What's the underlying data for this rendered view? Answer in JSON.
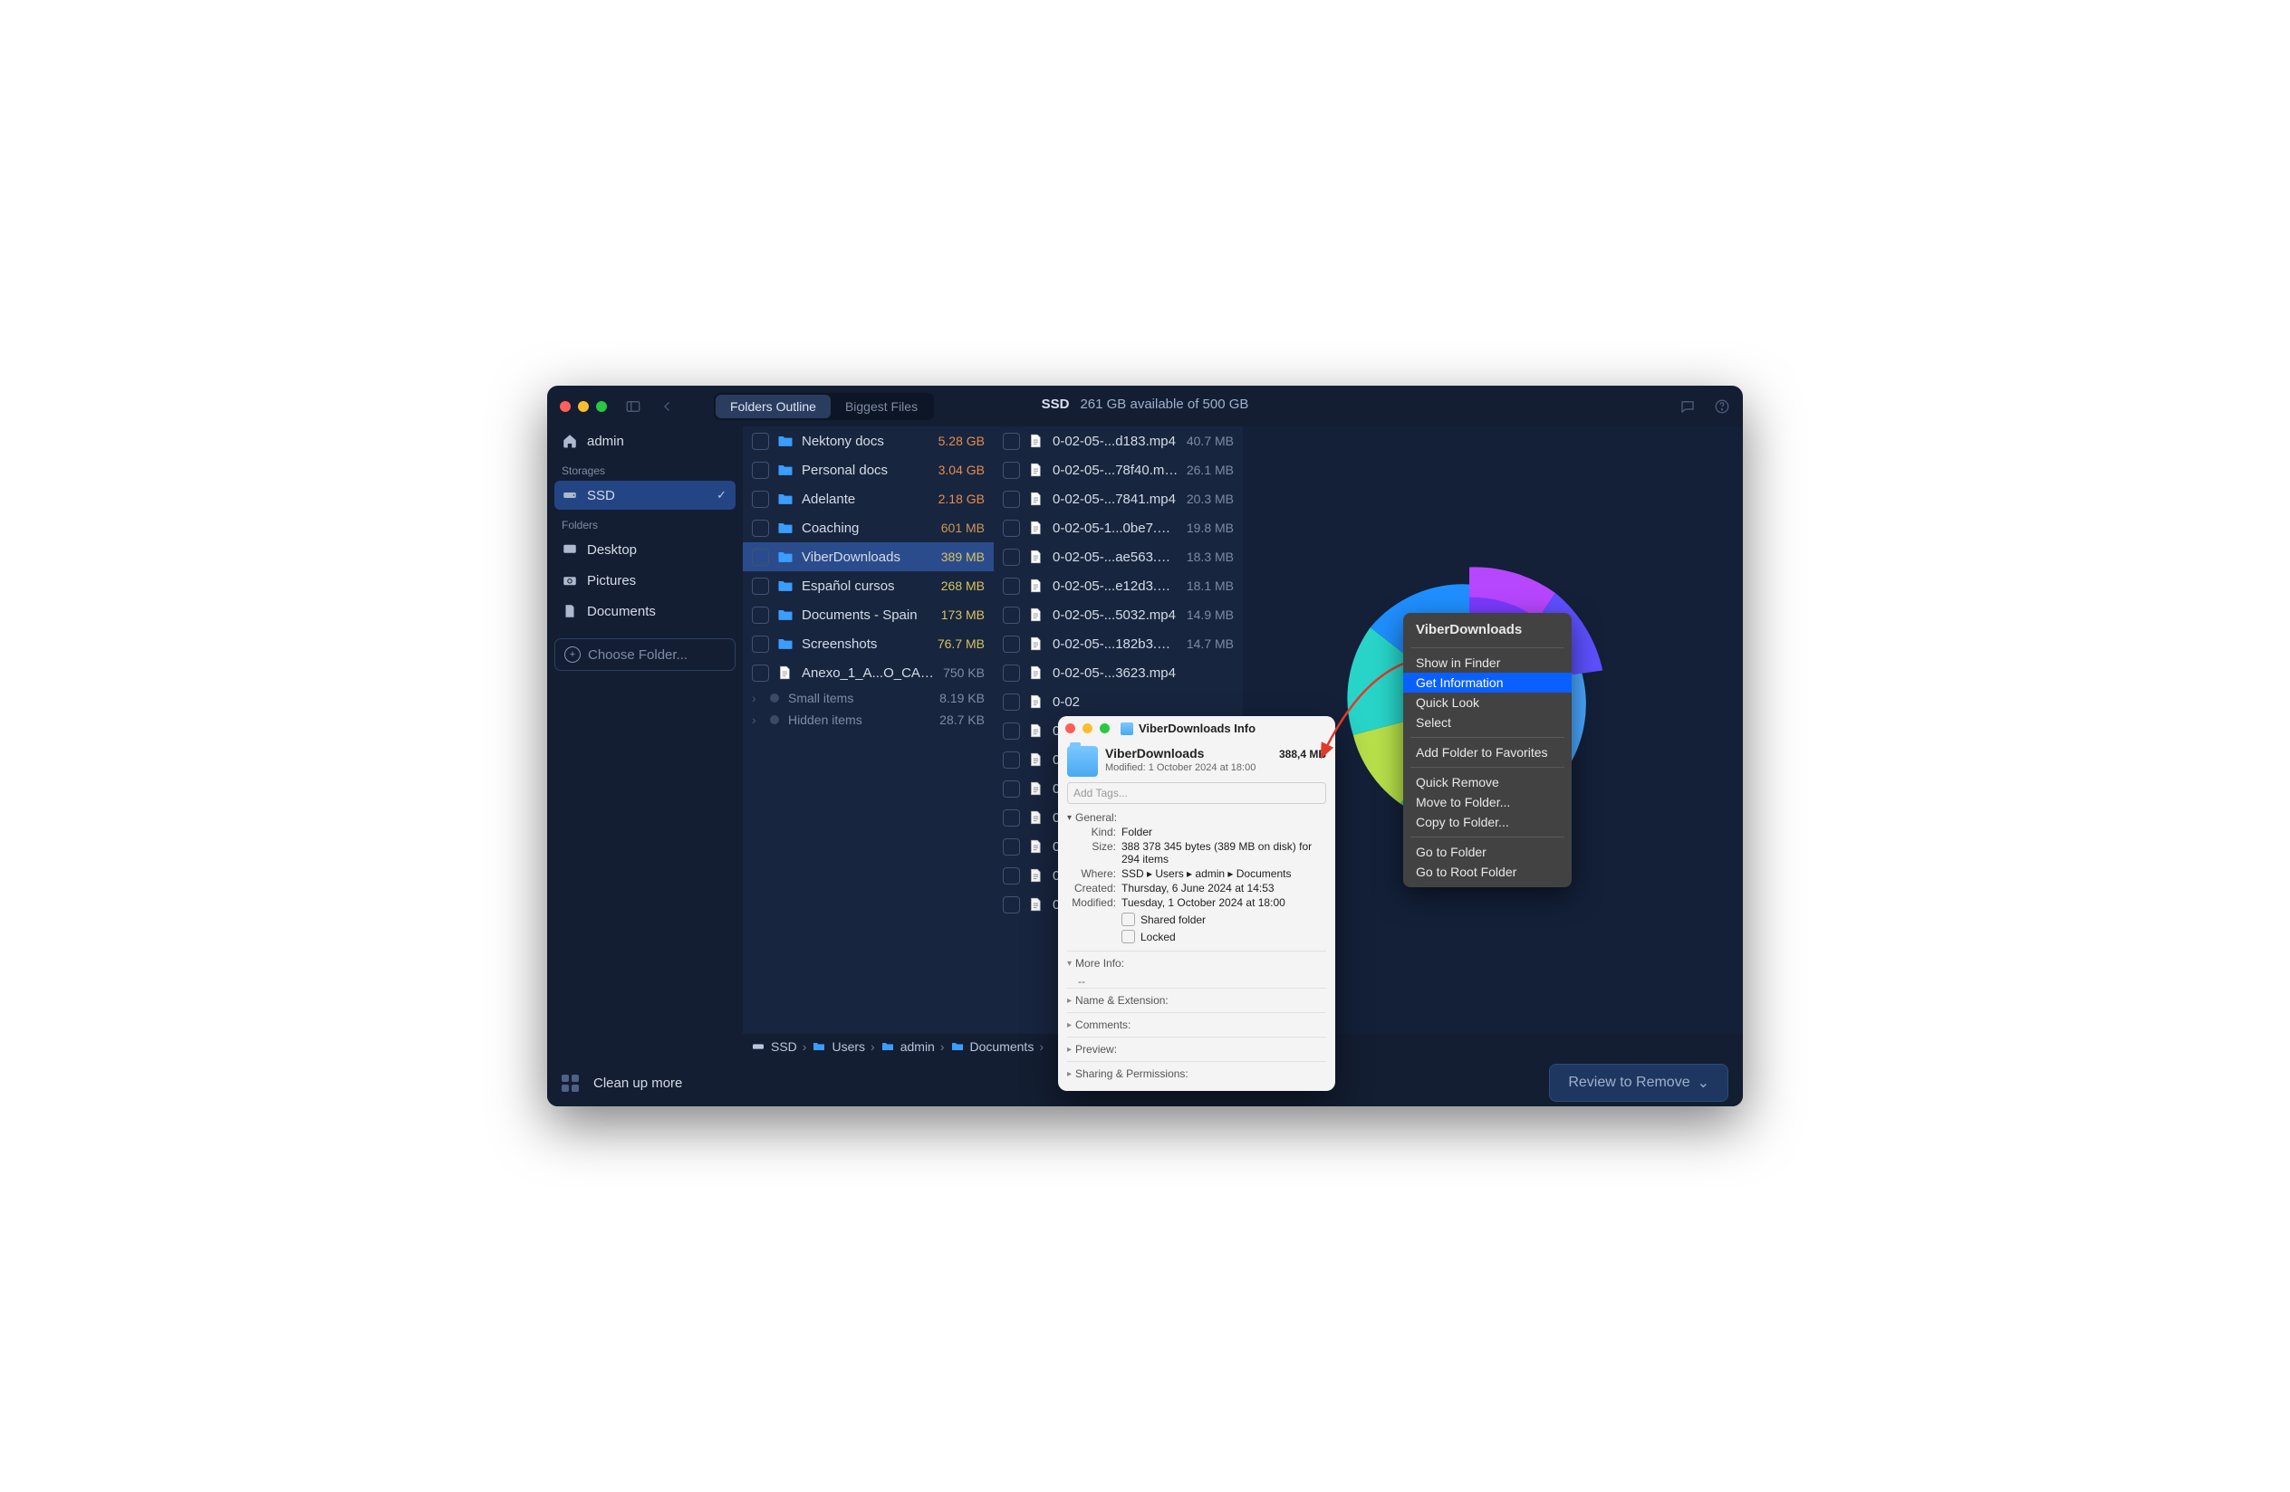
{
  "titlebar": {
    "seg_outline": "Folders Outline",
    "seg_biggest": "Biggest Files",
    "storage_name": "SSD",
    "storage_detail": "261 GB available of 500 GB"
  },
  "sidebar": {
    "home": "admin",
    "label_storages": "Storages",
    "ssd": "SSD",
    "label_folders": "Folders",
    "desktop": "Desktop",
    "pictures": "Pictures",
    "documents": "Documents",
    "choose": "Choose Folder..."
  },
  "col1": {
    "items": [
      {
        "name": "Nektony docs",
        "size": "5.28 GB",
        "cls": "orange",
        "type": "folder"
      },
      {
        "name": "Personal docs",
        "size": "3.04 GB",
        "cls": "orange",
        "type": "folder"
      },
      {
        "name": "Adelante",
        "size": "2.18 GB",
        "cls": "orange",
        "type": "folder"
      },
      {
        "name": "Coaching",
        "size": "601 MB",
        "cls": "amber",
        "type": "folder"
      },
      {
        "name": "ViberDownloads",
        "size": "389 MB",
        "cls": "yellow",
        "type": "folder",
        "selected": true
      },
      {
        "name": "Español cursos",
        "size": "268 MB",
        "cls": "yellow",
        "type": "folder"
      },
      {
        "name": "Documents - Spain",
        "size": "173 MB",
        "cls": "yellow",
        "type": "folder"
      },
      {
        "name": "Screenshots",
        "size": "76.7 MB",
        "cls": "yellow",
        "type": "folder"
      },
      {
        "name": "Anexo_1_A...O_CAS.pdf",
        "size": "750 KB",
        "cls": "",
        "type": "file"
      }
    ],
    "small": {
      "label": "Small items",
      "size": "8.19 KB"
    },
    "hidden": {
      "label": "Hidden items",
      "size": "28.7 KB"
    }
  },
  "col2": {
    "items": [
      {
        "name": "0-02-05-...d183.mp4",
        "size": "40.7 MB"
      },
      {
        "name": "0-02-05-...78f40.mp4",
        "size": "26.1 MB"
      },
      {
        "name": "0-02-05-...7841.mp4",
        "size": "20.3 MB"
      },
      {
        "name": "0-02-05-1...0be7.mp4",
        "size": "19.8 MB"
      },
      {
        "name": "0-02-05-...ae563.mp4",
        "size": "18.3 MB"
      },
      {
        "name": "0-02-05-...e12d3.mp4",
        "size": "18.1 MB"
      },
      {
        "name": "0-02-05-...5032.mp4",
        "size": "14.9 MB"
      },
      {
        "name": "0-02-05-...182b3.mp4",
        "size": "14.7 MB"
      },
      {
        "name": "0-02-05-...3623.mp4",
        "size": ""
      },
      {
        "name": "0-02",
        "size": ""
      },
      {
        "name": "0-02",
        "size": ""
      },
      {
        "name": "0-02",
        "size": ""
      },
      {
        "name": "0-02",
        "size": ""
      },
      {
        "name": "0-02",
        "size": ""
      },
      {
        "name": "0-02",
        "size": ""
      },
      {
        "name": "0-02",
        "size": ""
      },
      {
        "name": "0-02",
        "size": ""
      }
    ]
  },
  "crumbs": {
    "c0": "SSD",
    "c1": "Users",
    "c2": "admin",
    "c3": "Documents"
  },
  "bottom": {
    "cleanup": "Clean up more",
    "review": "Review to Remove"
  },
  "info": {
    "title": "ViberDownloads Info",
    "name": "ViberDownloads",
    "size": "388,4 MB",
    "modified_line": "Modified: 1 October 2024 at 18:00",
    "tags_placeholder": "Add Tags...",
    "general": "General:",
    "kind_k": "Kind:",
    "kind_v": "Folder",
    "size_k": "Size:",
    "size_v": "388 378 345 bytes (389 MB on disk) for 294 items",
    "where_k": "Where:",
    "where_v": "SSD ▸ Users ▸ admin ▸ Documents",
    "created_k": "Created:",
    "created_v": "Thursday, 6 June 2024 at 14:53",
    "mod_k": "Modified:",
    "mod_v": "Tuesday, 1 October 2024 at 18:00",
    "shared": "Shared folder",
    "locked": "Locked",
    "moreinfo": "More Info:",
    "dashes": "--",
    "nameext": "Name & Extension:",
    "comments": "Comments:",
    "preview": "Preview:",
    "sharing": "Sharing & Permissions:"
  },
  "menu": {
    "title": "ViberDownloads",
    "items": [
      "Show in Finder",
      "Get Information",
      "Quick Look",
      "Select",
      "Add Folder to Favorites",
      "Quick Remove",
      "Move to Folder...",
      "Copy to Folder...",
      "Go to Folder",
      "Go to Root Folder"
    ]
  }
}
